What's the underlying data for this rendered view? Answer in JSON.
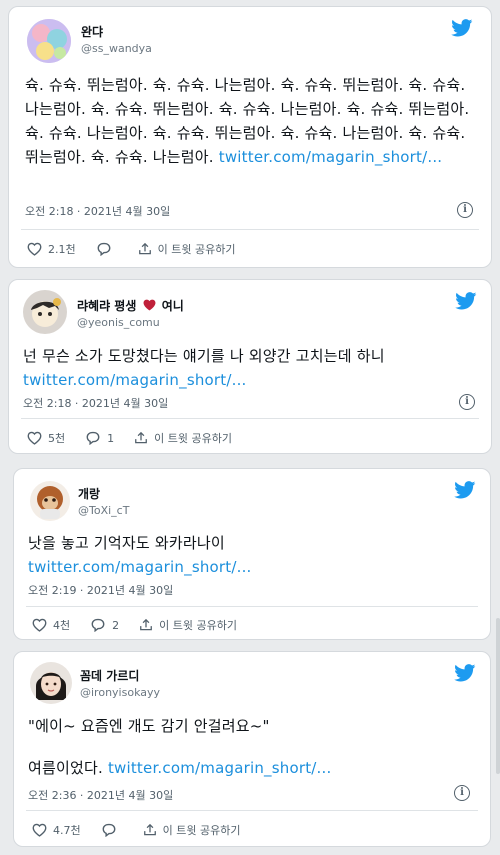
{
  "colors": {
    "twitter_blue": "#1d9bf0",
    "link": "#1c8fdc",
    "heart": "#c0203a"
  },
  "tweets": [
    {
      "display_name": "완댜",
      "handle": "@ss_wandya",
      "text": "슉. 슈슉. 뛰는럼아. 슉. 슈슉. 나는럼아. 슉. 슈슉. 뛰는럼아. 슉. 슈슉. 나는럼아. 슉. 슈슉. 뛰는럼아. 슉. 슈슉. 나는럼아. 슉. 슈슉. 뛰는럼아. 슉. 슈슉. 나는럼아. 슉. 슈슉. 뛰는럼아. 슉. 슈슉. 나는럼아. 슉. 슈슉. 뛰는럼아. 슉. 슈슉. 나는럼아.",
      "link": "twitter.com/magarin_short/...",
      "timestamp": "오전 2:18 · 2021년 4월 30일",
      "likes": "2.1천",
      "replies": "",
      "share": "이 트윗 공유하기"
    },
    {
      "display_name_pre": "랴혜랴 평생",
      "display_name_post": "여니",
      "handle": "@yeonis_comu",
      "text": "넌 무슨 소가 도망쳤다는 얘기를 나 외양간 고치는데 하니",
      "link": "twitter.com/magarin_short/...",
      "timestamp": "오전 2:18 · 2021년 4월 30일",
      "likes": "5천",
      "replies": "1",
      "share": "이 트윗 공유하기"
    },
    {
      "display_name": "개랑",
      "handle": "@ToXi_cT",
      "text": "낫을 놓고 기억자도 와카라나이",
      "link": "twitter.com/magarin_short/...",
      "timestamp": "오전 2:19 · 2021년 4월 30일",
      "likes": "4천",
      "replies": "2",
      "share": "이 트윗 공유하기"
    },
    {
      "display_name": "꼼데 가르디",
      "handle": "@ironyisokayy",
      "text_line1": "\"에이~ 요즘엔 개도 감기 안걸려요~\"",
      "text_line2": "여름이었다.",
      "link": "twitter.com/magarin_short/...",
      "timestamp": "오전 2:36 · 2021년 4월 30일",
      "likes": "4.7천",
      "replies": "",
      "share": "이 트윗 공유하기"
    }
  ]
}
